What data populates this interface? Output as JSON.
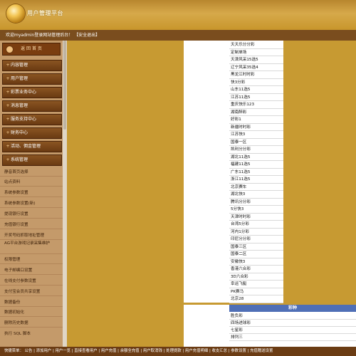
{
  "header": {
    "logo_text": "用户管理平台"
  },
  "welcome": {
    "text": "欢迎myadmin登录网站管理后台！ 【安全退出】"
  },
  "sidebar": {
    "back_label": "返 回 首 页",
    "menus": [
      "内容管理",
      "用户管理",
      "彩票业务中心",
      "消息管理",
      "服务支持中心",
      "财务中心",
      "活动、佣金管理",
      "系统管理"
    ],
    "sub_items": [
      "静音首页选择",
      "站点资料",
      "系统参数设置",
      "系统参数设置(新)",
      "提现银行设置",
      "充值银行设置",
      "开奖号码抓取地址管理",
      "AG平台游戏记录采集维护",
      "权限管理",
      "电子邮编口设置",
      "在线支付参数设置",
      "支付宝会员共享设置",
      "数据备份",
      "数据初始化",
      "删除历史数据",
      "执行 SQL 脚本"
    ]
  },
  "lottery_list": [
    "天天乐分分彩",
    "定制单场",
    "天津风采15选5",
    "辽宁风采35选4",
    "黑龙江时时彩",
    "快3分彩",
    "山东11选5",
    "江苏11选5",
    "重庆快乐123",
    "湖南醉彩",
    "好彩1",
    "新疆时时彩",
    "江苏快3",
    "国泰一区",
    "凯利分分彩",
    "湖北11选5",
    "福建11选5",
    "广东11选5",
    "浙江11选5",
    "北京赛车",
    "湖北快3",
    "腾讯分分彩",
    "5分快3",
    "天津时时彩",
    "台湾5分彩",
    "河内1分彩",
    "印尼分分彩",
    "国泰三区",
    "国泰二区",
    "安徽快3",
    "香港六合彩",
    "3D六合彩",
    "幸运飞艇",
    "PK赛马",
    "北京28"
  ],
  "games": {
    "header": "彩种",
    "items": [
      "胜负彩",
      "四场进球彩",
      "七星彩",
      "排列三"
    ]
  },
  "footer": {
    "text": "快捷菜单： 公告 | 添加用户 | 用户一览 | 直接查看用户 | 用户充值 | 余额全充值 | 用户取消钱 | 处理提款 | 用户充值明细 | 收支汇总 | 参数设置 | 充值赠送设置"
  }
}
